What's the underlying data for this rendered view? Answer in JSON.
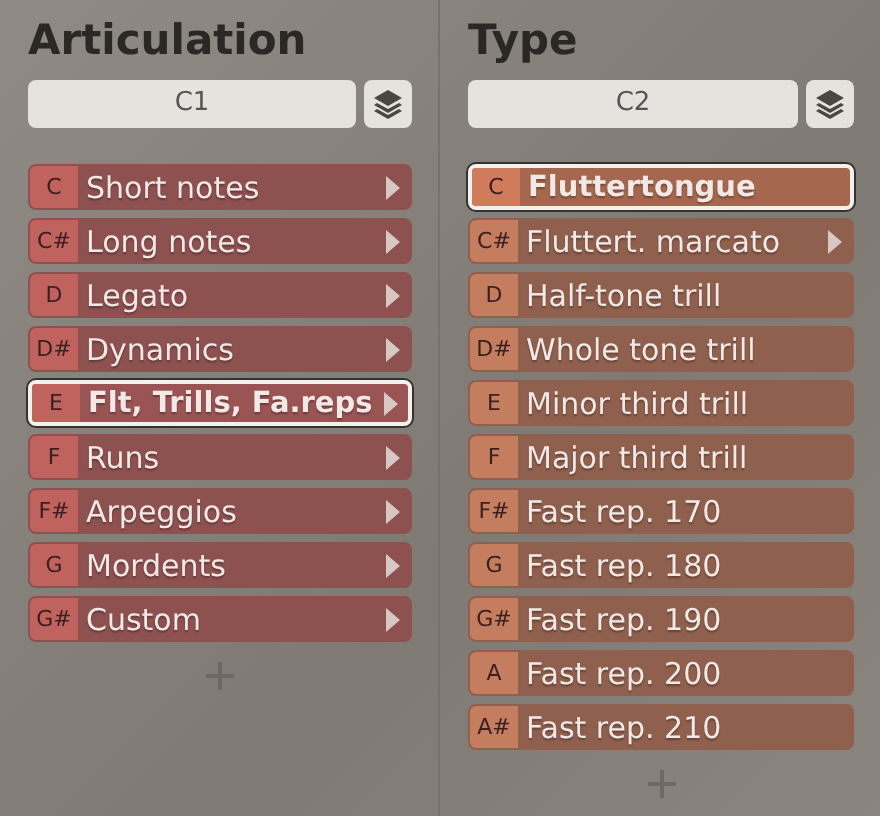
{
  "panels": [
    {
      "title": "Articulation",
      "field": {
        "value": "C1"
      },
      "items": [
        {
          "key": "C",
          "label": "Short notes",
          "selected": false,
          "submenu": true
        },
        {
          "key": "C#",
          "label": "Long notes",
          "selected": false,
          "submenu": true
        },
        {
          "key": "D",
          "label": "Legato",
          "selected": false,
          "submenu": true
        },
        {
          "key": "D#",
          "label": "Dynamics",
          "selected": false,
          "submenu": true
        },
        {
          "key": "E",
          "label": "Flt, Trills, Fa.reps",
          "selected": true,
          "submenu": true
        },
        {
          "key": "F",
          "label": "Runs",
          "selected": false,
          "submenu": true
        },
        {
          "key": "F#",
          "label": "Arpeggios",
          "selected": false,
          "submenu": true
        },
        {
          "key": "G",
          "label": "Mordents",
          "selected": false,
          "submenu": true
        },
        {
          "key": "G#",
          "label": "Custom",
          "selected": false,
          "submenu": true
        }
      ]
    },
    {
      "title": "Type",
      "field": {
        "value": "C2"
      },
      "items": [
        {
          "key": "C",
          "label": "Fluttertongue",
          "selected": true,
          "submenu": false
        },
        {
          "key": "C#",
          "label": "Fluttert. marcato",
          "selected": false,
          "submenu": true
        },
        {
          "key": "D",
          "label": "Half-tone trill",
          "selected": false,
          "submenu": false
        },
        {
          "key": "D#",
          "label": "Whole tone trill",
          "selected": false,
          "submenu": false
        },
        {
          "key": "E",
          "label": "Minor third trill",
          "selected": false,
          "submenu": false
        },
        {
          "key": "F",
          "label": "Major third trill",
          "selected": false,
          "submenu": false
        },
        {
          "key": "F#",
          "label": "Fast rep. 170",
          "selected": false,
          "submenu": false
        },
        {
          "key": "G",
          "label": "Fast rep. 180",
          "selected": false,
          "submenu": false
        },
        {
          "key": "G#",
          "label": "Fast rep. 190",
          "selected": false,
          "submenu": false
        },
        {
          "key": "A",
          "label": "Fast rep. 200",
          "selected": false,
          "submenu": false
        },
        {
          "key": "A#",
          "label": "Fast rep. 210",
          "selected": false,
          "submenu": false
        }
      ]
    }
  ]
}
